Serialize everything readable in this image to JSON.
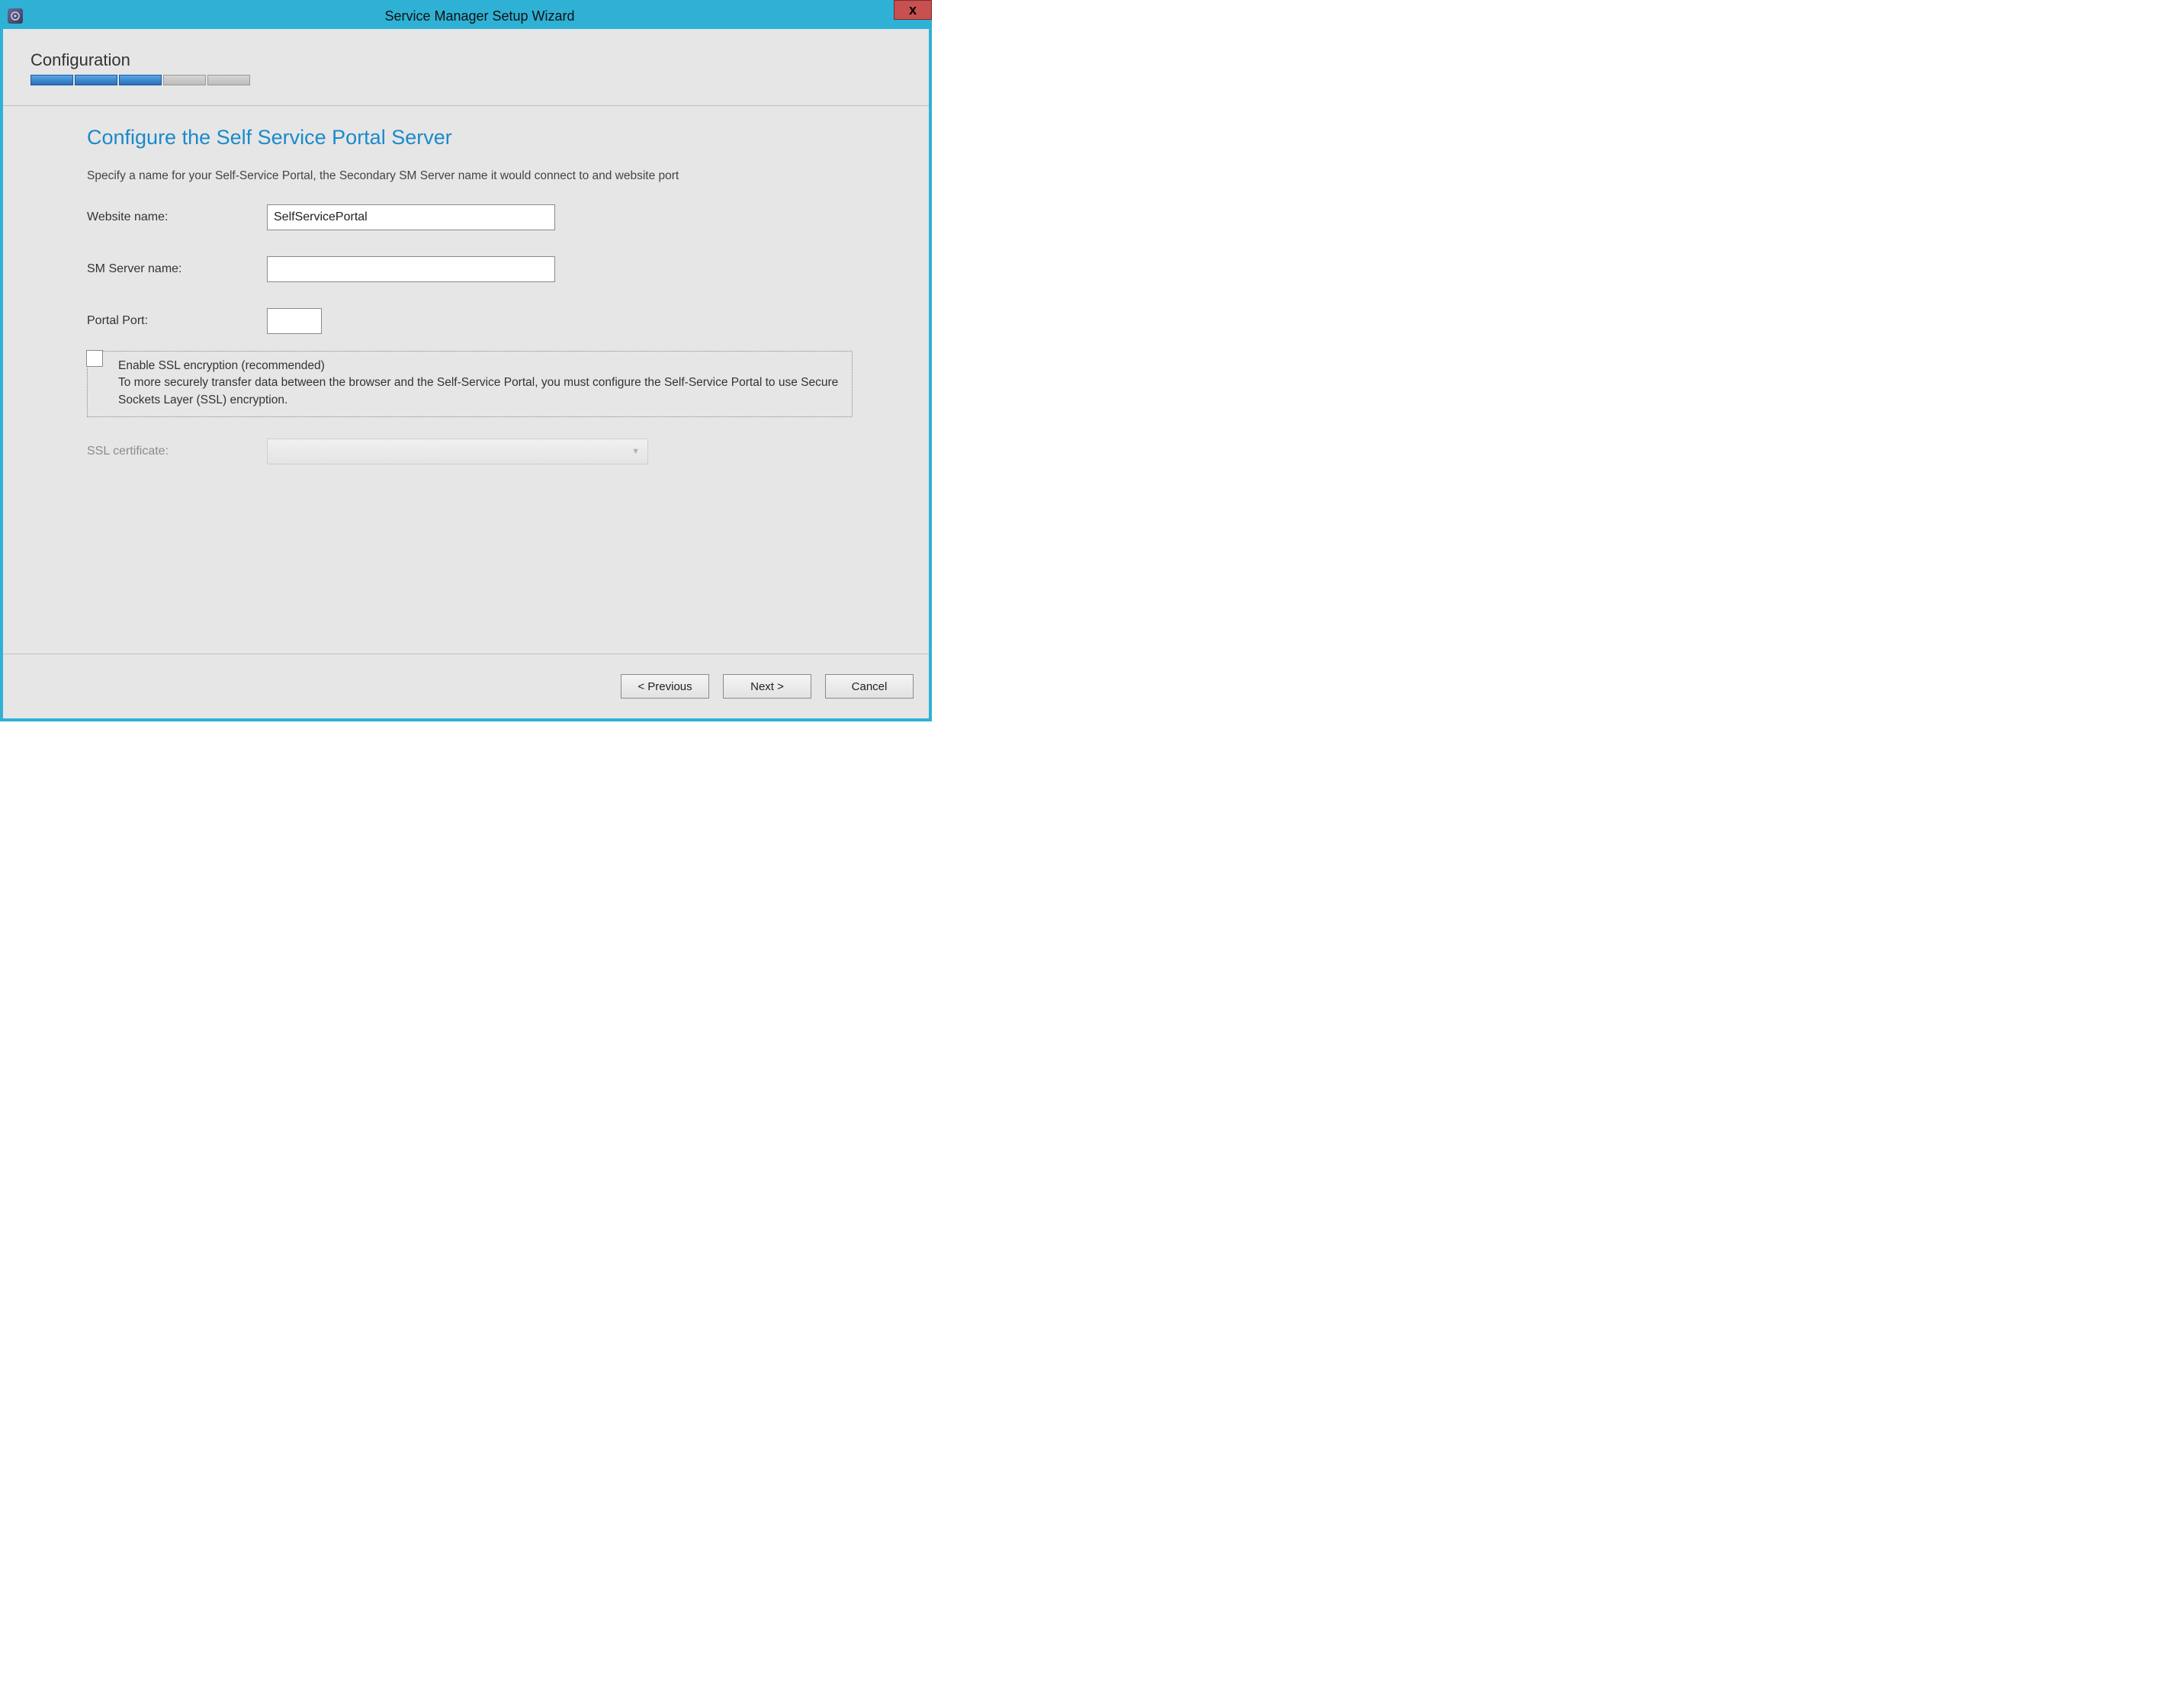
{
  "window": {
    "title": "Service Manager Setup Wizard",
    "close_label": "x"
  },
  "header": {
    "section_title": "Configuration",
    "progress_total": 5,
    "progress_done": 3
  },
  "page": {
    "title": "Configure the Self Service Portal Server",
    "subtitle": "Specify a name for your Self-Service Portal, the Secondary SM Server name it would connect to and website port"
  },
  "form": {
    "website_name_label": "Website name:",
    "website_name_value": "SelfServicePortal",
    "sm_server_label": "SM Server name:",
    "sm_server_value": "",
    "portal_port_label": "Portal Port:",
    "portal_port_value": "",
    "ssl_checkbox_checked": false,
    "ssl_title": "Enable SSL encryption (recommended)",
    "ssl_desc": "To more securely transfer data between the browser and the Self-Service Portal, you must configure the Self-Service Portal to use Secure Sockets Layer (SSL) encryption.",
    "ssl_cert_label": "SSL certificate:",
    "ssl_cert_value": ""
  },
  "footer": {
    "previous_label": "< Previous",
    "next_label": "Next >",
    "cancel_label": "Cancel"
  },
  "colors": {
    "accent": "#2fb1d6",
    "heading_blue": "#1a8acb",
    "close_red": "#c75050"
  }
}
